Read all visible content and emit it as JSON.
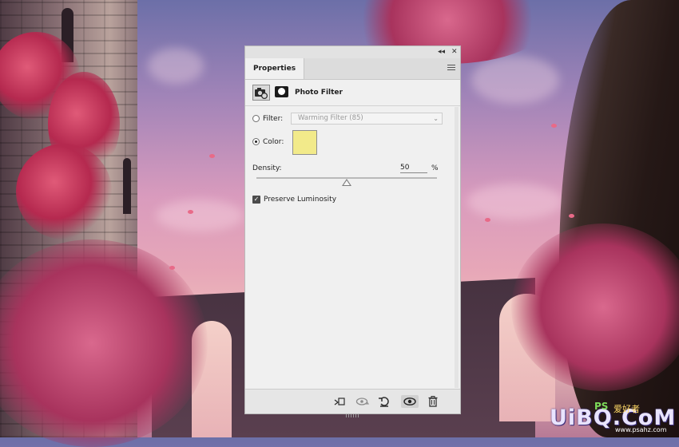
{
  "panel": {
    "title_buttons": {
      "collapse": "◂◂",
      "close": "✕"
    },
    "tab_label": "Properties",
    "menu_icon": "panel-menu-icon",
    "adjustment": {
      "icon": "photo-filter-adjustment-icon",
      "mask_icon": "layer-mask-icon",
      "title": "Photo Filter"
    },
    "filter": {
      "label": "Filter:",
      "selected": "Warming Filter (85)",
      "enabled": false
    },
    "color": {
      "label": "Color:",
      "selected": true,
      "swatch_hex": "#f2ea8a"
    },
    "density": {
      "label": "Density:",
      "value": "50",
      "unit": "%",
      "level": 0.5
    },
    "preserve_luminosity": {
      "label": "Preserve Luminosity",
      "checked": true
    },
    "footer_icons": [
      "clip-to-layer-icon",
      "view-previous-state-icon",
      "reset-icon",
      "visibility-eye-icon",
      "delete-trash-icon"
    ]
  },
  "watermark": {
    "main": "UiBQ.CoM",
    "ps": "PS",
    "cn": "爱好者",
    "url": "www.psahz.com"
  }
}
